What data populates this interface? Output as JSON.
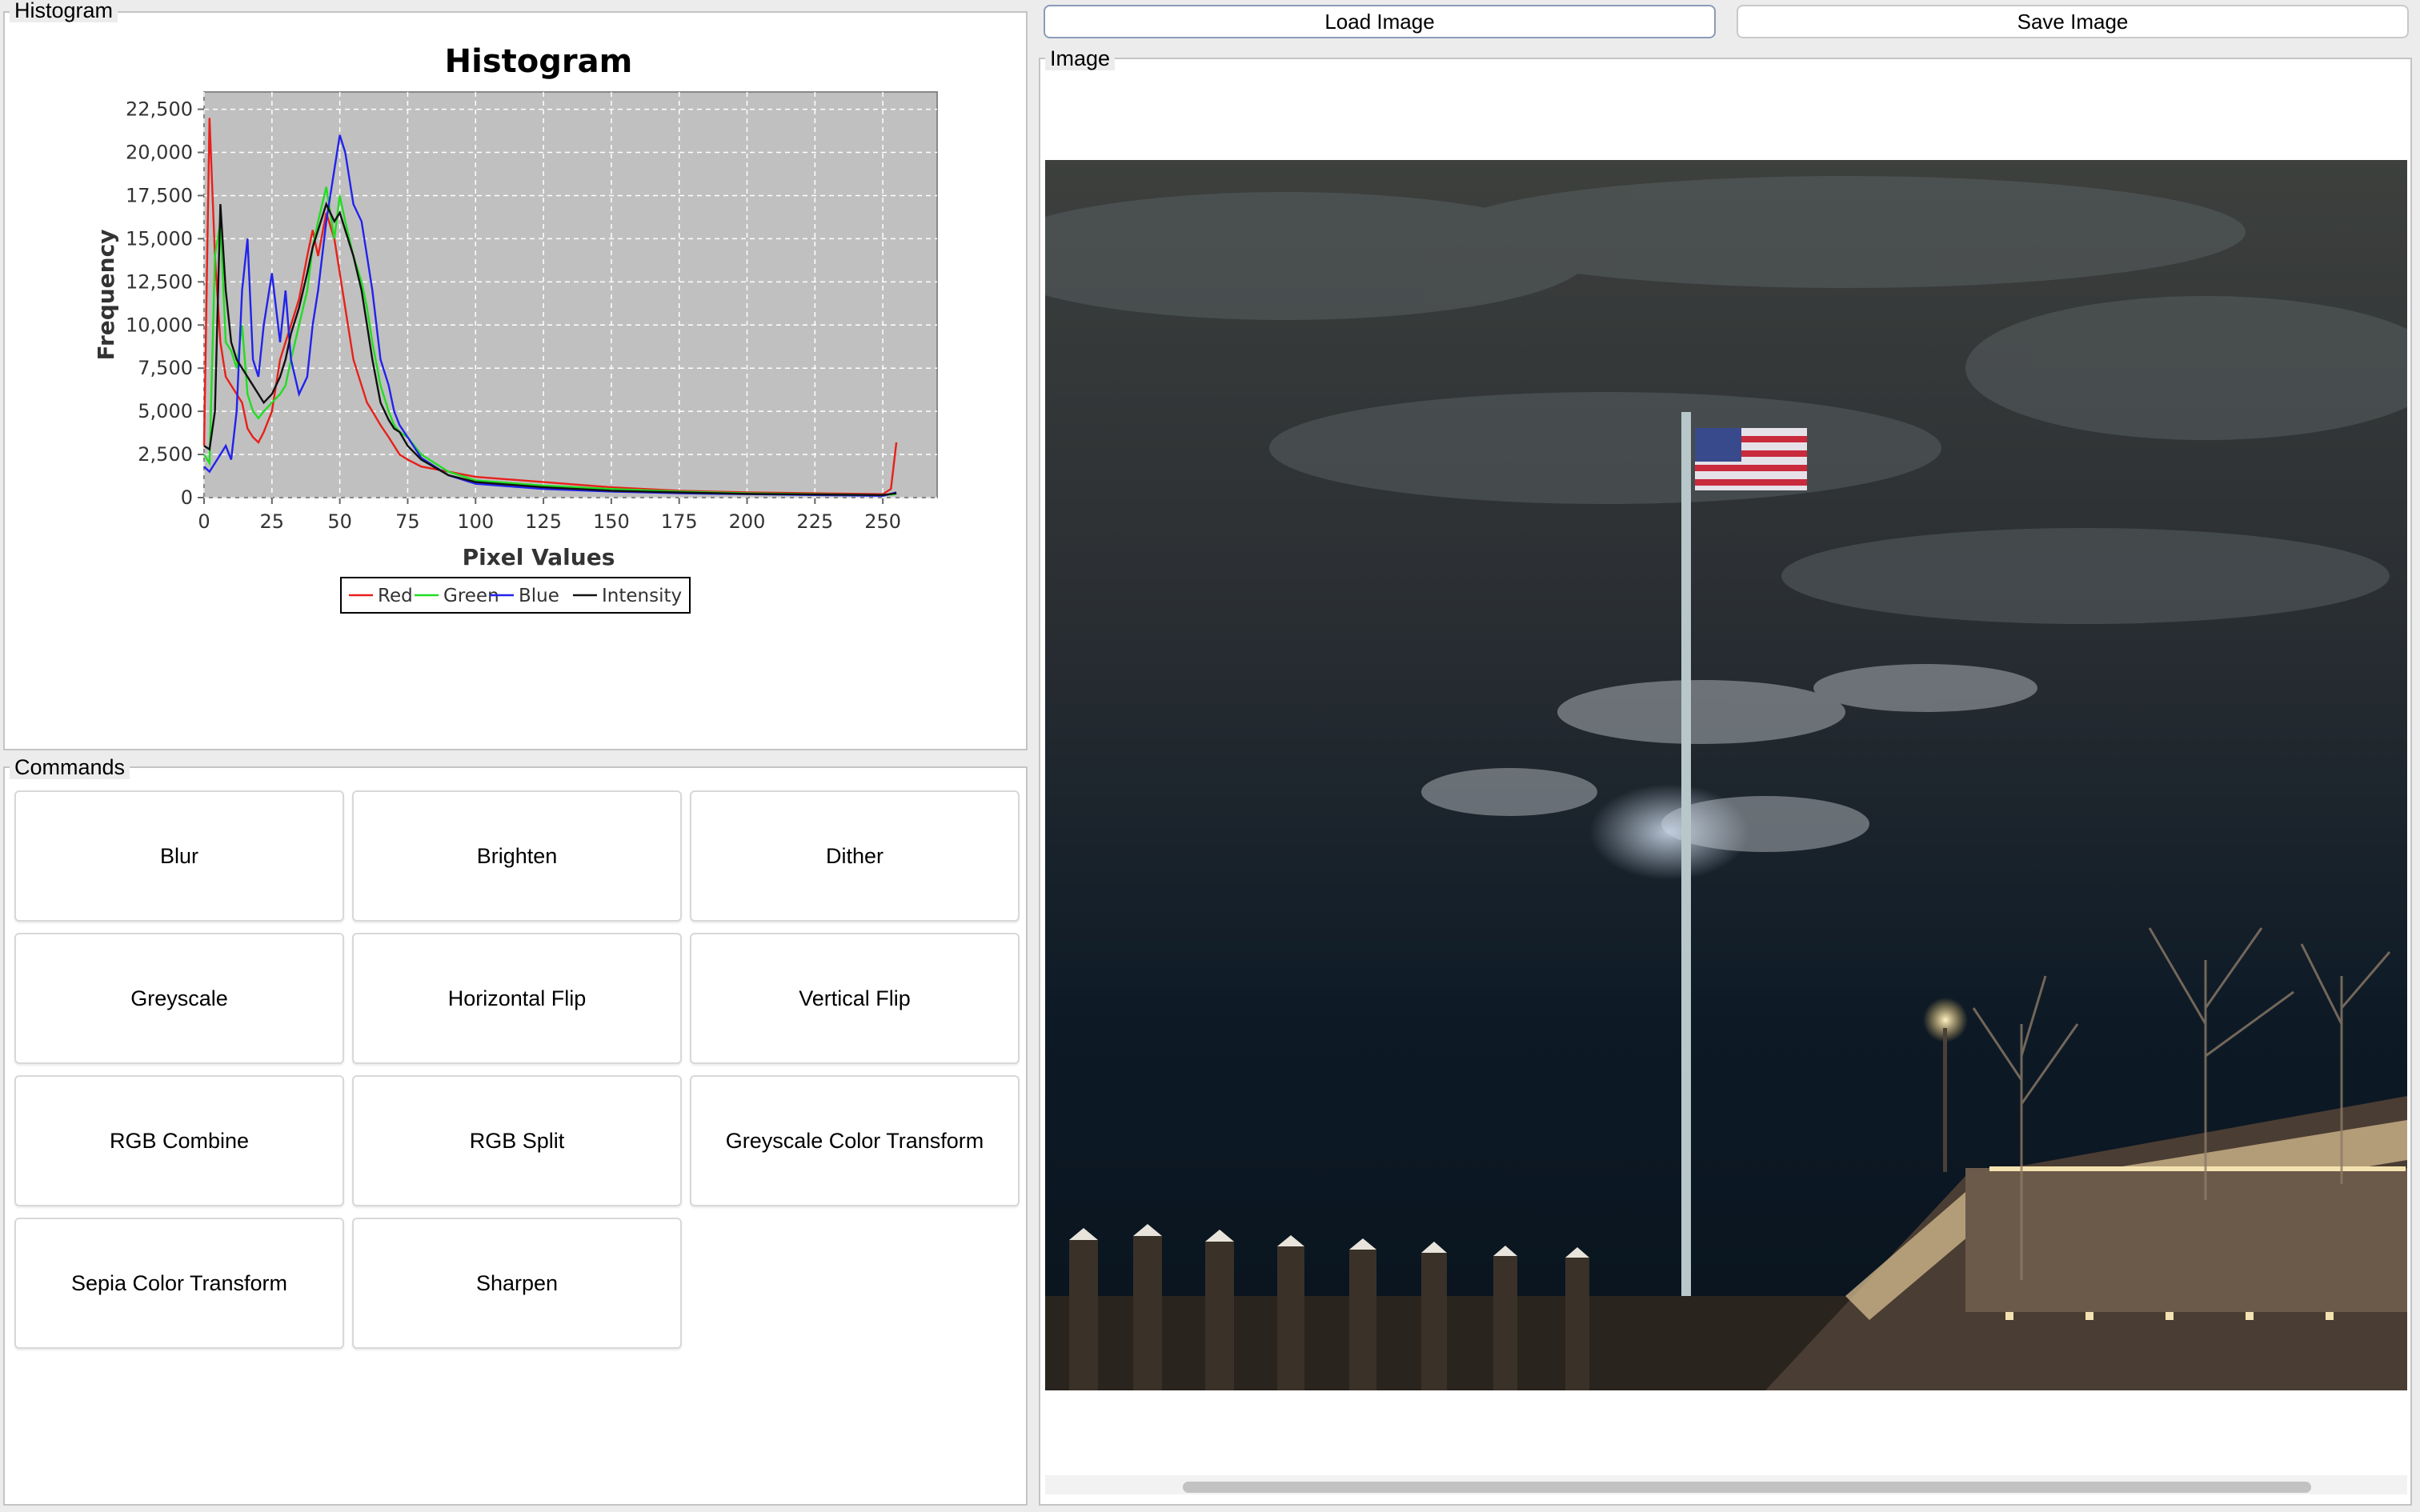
{
  "toolbar": {
    "load_label": "Load Image",
    "save_label": "Save Image"
  },
  "panels": {
    "histogram_title": "Histogram",
    "commands_title": "Commands",
    "image_title": "Image"
  },
  "commands": [
    "Blur",
    "Brighten",
    "Dither",
    "Greyscale",
    "Horizontal Flip",
    "Vertical Flip",
    "RGB Combine",
    "RGB Split",
    "Greyscale Color Transform",
    "Sepia Color Transform",
    "Sharpen"
  ],
  "chart_data": {
    "type": "line",
    "title": "Histogram",
    "xlabel": "Pixel Values",
    "ylabel": "Frequency",
    "xlim": [
      0,
      270
    ],
    "ylim": [
      0,
      23500
    ],
    "xticks": [
      0,
      25,
      50,
      75,
      100,
      125,
      150,
      175,
      200,
      225,
      250
    ],
    "yticks": [
      0,
      2500,
      5000,
      7500,
      10000,
      12500,
      15000,
      17500,
      20000,
      22500
    ],
    "ytick_labels": [
      "0",
      "2,500",
      "5,000",
      "7,500",
      "10,000",
      "12,500",
      "15,000",
      "17,500",
      "20,000",
      "22,500"
    ],
    "grid": true,
    "legend_position": "bottom",
    "colors": {
      "plot_bg": "#c0c0c0",
      "Red": "#e8201a",
      "Green": "#22dd22",
      "Blue": "#2222ee",
      "Intensity": "#111111"
    },
    "series": [
      {
        "name": "Red",
        "x": [
          0,
          2,
          4,
          6,
          8,
          10,
          12,
          14,
          16,
          18,
          20,
          22,
          25,
          28,
          30,
          32,
          35,
          38,
          40,
          42,
          45,
          48,
          50,
          52,
          55,
          58,
          60,
          62,
          65,
          68,
          70,
          72,
          75,
          80,
          90,
          100,
          125,
          150,
          175,
          200,
          225,
          250,
          253,
          255
        ],
        "y": [
          3000,
          22000,
          14000,
          9000,
          7000,
          6500,
          6000,
          5500,
          4000,
          3500,
          3200,
          3800,
          5000,
          8000,
          9000,
          10000,
          11500,
          14000,
          15500,
          14000,
          16500,
          15000,
          13000,
          11000,
          8000,
          6500,
          5500,
          5000,
          4200,
          3500,
          3000,
          2500,
          2200,
          1800,
          1500,
          1200,
          900,
          600,
          400,
          300,
          250,
          200,
          500,
          3200
        ]
      },
      {
        "name": "Green",
        "x": [
          0,
          2,
          4,
          6,
          8,
          10,
          12,
          14,
          16,
          18,
          20,
          22,
          25,
          28,
          30,
          32,
          35,
          38,
          40,
          42,
          45,
          48,
          50,
          52,
          55,
          58,
          60,
          62,
          65,
          68,
          70,
          72,
          75,
          80,
          90,
          100,
          125,
          150,
          175,
          200,
          225,
          250,
          255
        ],
        "y": [
          2500,
          2000,
          14000,
          16000,
          9000,
          8500,
          7500,
          10000,
          6000,
          5000,
          4600,
          5000,
          5500,
          6000,
          6500,
          8000,
          10000,
          12000,
          14500,
          16000,
          18000,
          15000,
          17500,
          16000,
          14000,
          12500,
          11000,
          9000,
          6500,
          5000,
          4200,
          3800,
          3500,
          2500,
          1500,
          1000,
          700,
          500,
          350,
          250,
          200,
          150,
          200
        ]
      },
      {
        "name": "Blue",
        "x": [
          0,
          2,
          4,
          6,
          8,
          10,
          12,
          14,
          16,
          18,
          20,
          22,
          25,
          28,
          30,
          32,
          35,
          38,
          40,
          42,
          45,
          48,
          50,
          52,
          55,
          58,
          60,
          62,
          65,
          68,
          70,
          72,
          75,
          80,
          90,
          100,
          125,
          150,
          175,
          200,
          225,
          250,
          255
        ],
        "y": [
          1800,
          1500,
          2000,
          2500,
          3000,
          2200,
          5000,
          12000,
          15000,
          8000,
          7000,
          10000,
          13000,
          9000,
          12000,
          8000,
          6000,
          7000,
          10000,
          12000,
          16000,
          19000,
          21000,
          20000,
          17000,
          16000,
          14000,
          12000,
          8000,
          6500,
          5000,
          4200,
          3500,
          2300,
          1300,
          800,
          500,
          350,
          250,
          200,
          150,
          100,
          300
        ]
      },
      {
        "name": "Intensity",
        "x": [
          0,
          2,
          4,
          6,
          8,
          10,
          12,
          14,
          16,
          18,
          20,
          22,
          25,
          28,
          30,
          32,
          35,
          38,
          40,
          42,
          45,
          48,
          50,
          52,
          55,
          58,
          60,
          62,
          65,
          68,
          70,
          72,
          75,
          80,
          90,
          100,
          125,
          150,
          175,
          200,
          225,
          250,
          255
        ],
        "y": [
          3000,
          2800,
          5000,
          17000,
          12000,
          9000,
          8000,
          7500,
          7000,
          6500,
          6000,
          5500,
          6000,
          7000,
          8000,
          9500,
          11000,
          13000,
          14500,
          15500,
          17000,
          16000,
          16500,
          15500,
          14000,
          12000,
          10000,
          8000,
          5500,
          4500,
          4000,
          3800,
          3000,
          2200,
          1300,
          900,
          600,
          400,
          300,
          220,
          180,
          150,
          250
        ]
      }
    ]
  }
}
